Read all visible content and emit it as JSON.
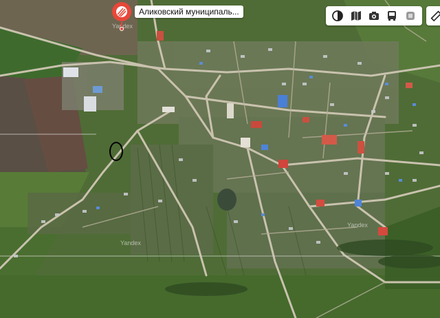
{
  "place": {
    "label": "Аликовский муниципаль..."
  },
  "toolbar": {
    "tools": [
      {
        "icon": "layers-icon"
      },
      {
        "icon": "map-book-icon"
      },
      {
        "icon": "panorama-camera-icon"
      },
      {
        "icon": "transport-bus-icon"
      },
      {
        "icon": "traffic-icon"
      }
    ],
    "ruler_icon": "ruler-icon"
  },
  "watermarks": [
    "Yandex",
    "Yandex",
    "Yandex"
  ],
  "colors": {
    "road": "#c9c2ae",
    "field_brown": "#6b5a4a",
    "field_green": "#5f8a3a",
    "marker_red": "#e8473a",
    "selection": "#000000"
  }
}
